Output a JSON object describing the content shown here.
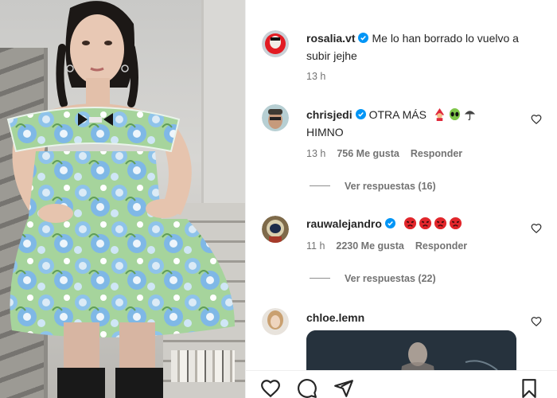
{
  "caption": {
    "username": "rosalia.vt",
    "text": "Me lo han borrado lo vuelvo a subir jejhe",
    "time": "13 h"
  },
  "comments": [
    {
      "username": "chrisjedi",
      "text": "OTRA MÁS",
      "text_line2": "HIMNO",
      "emojis": [
        "woman-mage-emoji",
        "alien-emoji",
        "umbrella-rain-emoji"
      ],
      "time": "13 h",
      "likes": "756 Me gusta",
      "reply_label": "Responder",
      "view_replies": "Ver respuestas (16)"
    },
    {
      "username": "rauwalejandro",
      "emojis": [
        "pouting-face-emoji",
        "pouting-face-emoji",
        "pouting-face-emoji",
        "pouting-face-emoji"
      ],
      "time": "11 h",
      "likes": "2230 Me gusta",
      "reply_label": "Responder",
      "view_replies": "Ver respuestas (22)"
    },
    {
      "username": "chloe.lemn"
    }
  ],
  "actions": [
    "heart-icon",
    "comment-icon",
    "share-icon",
    "save-icon"
  ],
  "colors": {
    "text": "#262626",
    "secondary": "#737373",
    "verified": "#0095f6",
    "dress_blue": "#8ec3ea",
    "dress_green": "#9fd09a"
  }
}
